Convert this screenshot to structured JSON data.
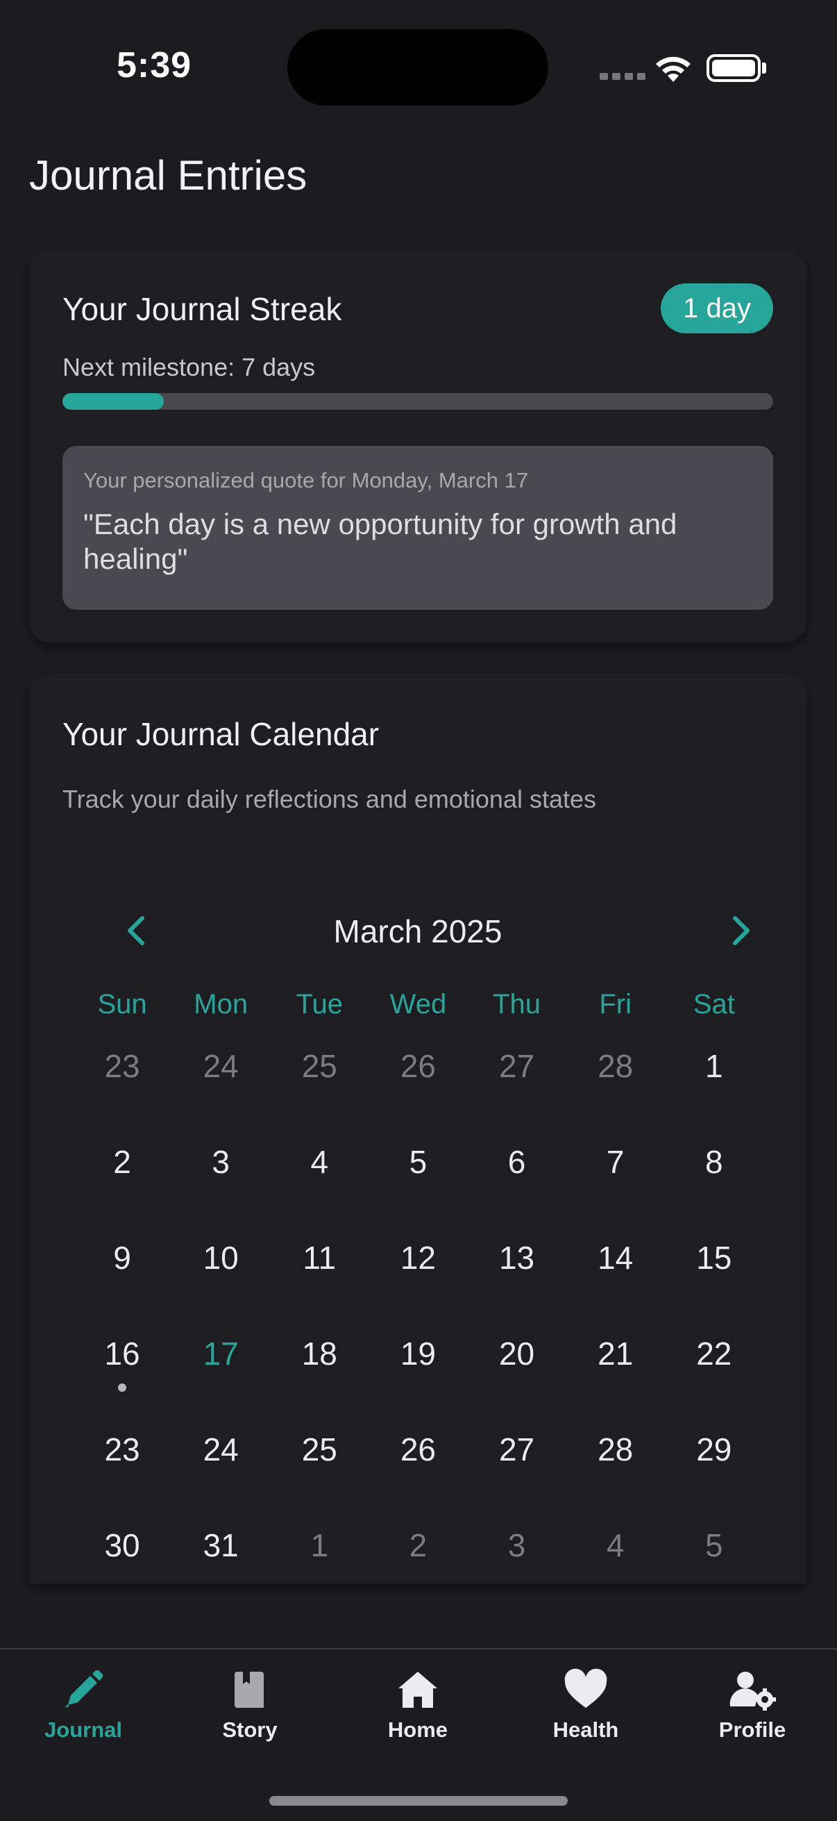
{
  "status_bar": {
    "time": "5:39"
  },
  "page": {
    "title": "Journal Entries"
  },
  "streak": {
    "title": "Your Journal Streak",
    "badge": "1 day",
    "milestone_label": "Next milestone: 7 days",
    "progress_fraction": 0.1428,
    "quote_label": "Your personalized quote for Monday, March 17",
    "quote_text": "\"Each day is a new opportunity for growth and healing\""
  },
  "calendar": {
    "title": "Your Journal Calendar",
    "subtitle": "Track your daily reflections and emotional states",
    "month_label": "March 2025",
    "weekdays": [
      "Sun",
      "Mon",
      "Tue",
      "Wed",
      "Thu",
      "Fri",
      "Sat"
    ],
    "weeks": [
      [
        {
          "d": "23",
          "m": true
        },
        {
          "d": "24",
          "m": true
        },
        {
          "d": "25",
          "m": true
        },
        {
          "d": "26",
          "m": true
        },
        {
          "d": "27",
          "m": true
        },
        {
          "d": "28",
          "m": true
        },
        {
          "d": "1"
        }
      ],
      [
        {
          "d": "2"
        },
        {
          "d": "3"
        },
        {
          "d": "4"
        },
        {
          "d": "5"
        },
        {
          "d": "6"
        },
        {
          "d": "7"
        },
        {
          "d": "8"
        }
      ],
      [
        {
          "d": "9"
        },
        {
          "d": "10"
        },
        {
          "d": "11"
        },
        {
          "d": "12"
        },
        {
          "d": "13"
        },
        {
          "d": "14"
        },
        {
          "d": "15"
        }
      ],
      [
        {
          "d": "16",
          "dot": true
        },
        {
          "d": "17",
          "today": true
        },
        {
          "d": "18"
        },
        {
          "d": "19"
        },
        {
          "d": "20"
        },
        {
          "d": "21"
        },
        {
          "d": "22"
        }
      ],
      [
        {
          "d": "23"
        },
        {
          "d": "24"
        },
        {
          "d": "25"
        },
        {
          "d": "26"
        },
        {
          "d": "27"
        },
        {
          "d": "28"
        },
        {
          "d": "29"
        }
      ],
      [
        {
          "d": "30"
        },
        {
          "d": "31"
        },
        {
          "d": "1",
          "m": true
        },
        {
          "d": "2",
          "m": true
        },
        {
          "d": "3",
          "m": true
        },
        {
          "d": "4",
          "m": true
        },
        {
          "d": "5",
          "m": true
        }
      ]
    ]
  },
  "tabs": [
    {
      "label": "Journal",
      "icon": "pencil-icon",
      "active": true
    },
    {
      "label": "Story",
      "icon": "book-icon",
      "active": false
    },
    {
      "label": "Home",
      "icon": "home-icon",
      "active": false
    },
    {
      "label": "Health",
      "icon": "heart-icon",
      "active": false
    },
    {
      "label": "Profile",
      "icon": "user-gear-icon",
      "active": false
    }
  ],
  "colors": {
    "accent": "#26a69a",
    "background": "#1c1c20",
    "quote_bg": "#4a4850"
  }
}
